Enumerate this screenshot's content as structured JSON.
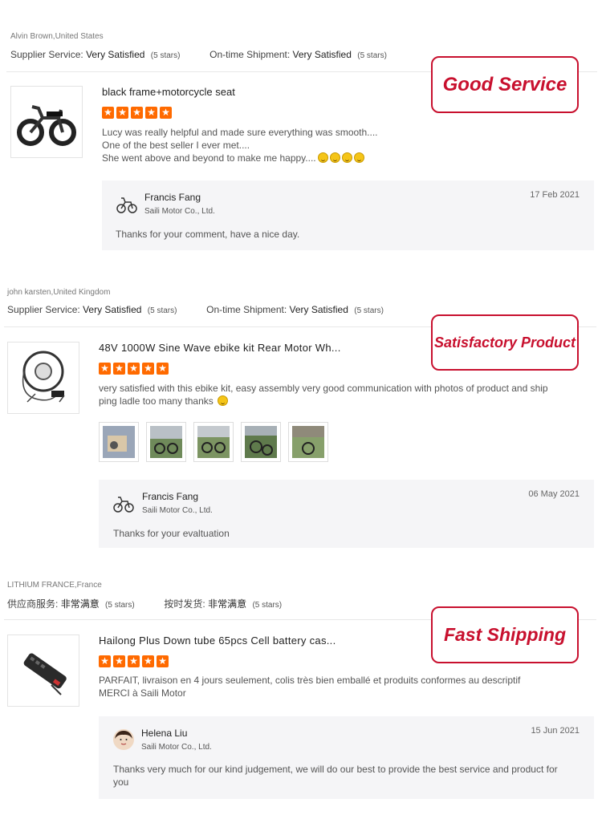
{
  "reviews": [
    {
      "reviewer": "Alvin Brown,United States",
      "supplier_label": "Supplier Service:",
      "supplier_value": "Very Satisfied",
      "supplier_stars": "(5 stars)",
      "shipment_label": "On-time Shipment:",
      "shipment_value": "Very Satisfied",
      "shipment_stars": "(5 stars)",
      "product_title": "black frame+motorcycle seat",
      "rating": 5,
      "text_lines": [
        "Lucy was really helpful and made sure everything was smooth....",
        "One of the best seller I ever met....",
        "She went above and beyond to make me happy...."
      ],
      "badge": "Good Service",
      "reply": {
        "name": "Francis Fang",
        "company": "Saili Motor Co., Ltd.",
        "date": "17 Feb 2021",
        "text": "Thanks for your comment, have a nice day."
      }
    },
    {
      "reviewer": "john karsten,United Kingdom",
      "supplier_label": "Supplier Service:",
      "supplier_value": "Very Satisfied",
      "supplier_stars": "(5 stars)",
      "shipment_label": "On-time Shipment:",
      "shipment_value": "Very Satisfied",
      "shipment_stars": "(5 stars)",
      "product_title": "48V 1000W Sine Wave ebike kit Rear Motor Wh...",
      "rating": 5,
      "text_lines": [
        "very satisfied with this ebike kit, easy assembly  very good communication with photos of product and ship",
        "ping ladle too many thanks"
      ],
      "badge": "Satisfactory Product",
      "reply": {
        "name": "Francis Fang",
        "company": "Saili Motor Co., Ltd.",
        "date": "06 May 2021",
        "text": "Thanks for your evaltuation"
      }
    },
    {
      "reviewer": "LITHIUM FRANCE,France",
      "supplier_label": "供应商服务:",
      "supplier_value": "非常满意",
      "supplier_stars": "(5 stars)",
      "shipment_label": "按时发货:",
      "shipment_value": "非常满意",
      "shipment_stars": "(5 stars)",
      "product_title": "Hailong Plus Down tube 65pcs Cell battery cas...",
      "rating": 5,
      "text_lines": [
        "PARFAIT, livraison en 4 jours seulement, colis très bien emballé et produits conformes au descriptif",
        "MERCI à Saili Motor"
      ],
      "badge": "Fast Shipping",
      "reply": {
        "name": "Helena Liu",
        "company": "Saili Motor Co., Ltd.",
        "date": "15 Jun 2021",
        "text_lines": [
          "Thanks very much for our kind judgement, we will do our best to provide the best service and product for",
          "you"
        ]
      }
    }
  ],
  "colors": {
    "star": "#ff6a00",
    "badge": "#c8102e",
    "reply_bg": "#f5f5f7"
  }
}
